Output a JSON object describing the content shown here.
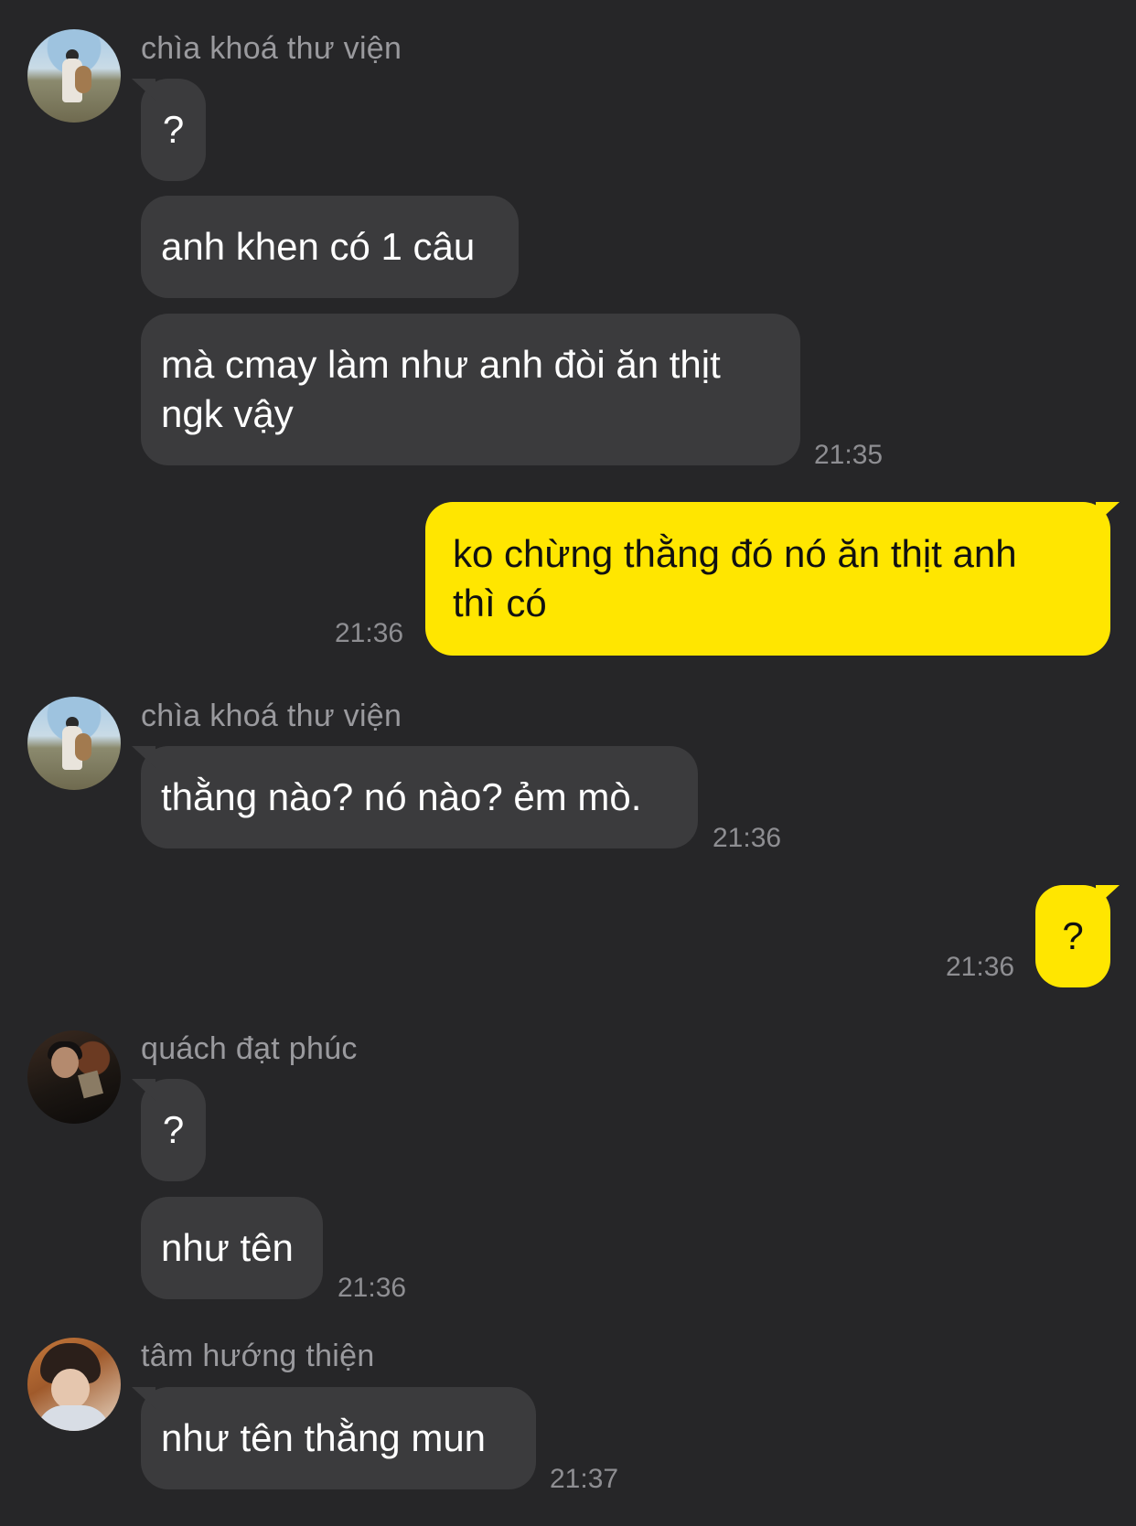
{
  "colors": {
    "background": "#262628",
    "incoming_bubble": "#3b3b3d",
    "outgoing_bubble": "#ffe600",
    "sender_name": "#9a9a9e",
    "timestamp": "#8e8e92"
  },
  "messages": [
    {
      "sender": "chìa khoá thư viện",
      "texts": [
        "?",
        "anh khen có 1 câu",
        "mà cmay làm như anh đòi ăn thịt\nngk vậy"
      ],
      "time": "21:35"
    },
    {
      "sender": "me",
      "texts": [
        "ko chừng thằng đó nó ăn thịt anh\nthì có"
      ],
      "time": "21:36"
    },
    {
      "sender": "chìa khoá thư viện",
      "texts": [
        "thằng nào? nó nào? ẻm mò."
      ],
      "time": "21:36"
    },
    {
      "sender": "me",
      "texts": [
        "?"
      ],
      "time": "21:36"
    },
    {
      "sender": "quách đạt phúc",
      "texts": [
        "?",
        "như tên"
      ],
      "time": "21:36"
    },
    {
      "sender": "tâm hướng thiện",
      "texts": [
        "như tên thằng mun"
      ],
      "time": "21:37"
    }
  ]
}
